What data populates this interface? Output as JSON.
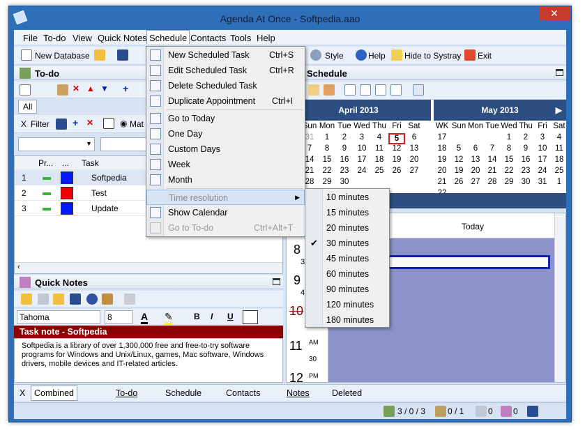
{
  "window": {
    "title": "Agenda At Once - Softpedia.aao",
    "close": "✕"
  },
  "menubar": {
    "items": [
      "File",
      "To-do",
      "View",
      "Quick Notes",
      "Schedule",
      "Contacts",
      "Tools",
      "Help"
    ]
  },
  "toolbar": {
    "new_database": "New Database",
    "style": "Style",
    "help": "Help",
    "hide": "Hide to Systray",
    "exit": "Exit"
  },
  "todo": {
    "title": "To-do",
    "all_tab": "All",
    "filter": "Filter",
    "mat": "Mat",
    "columns": {
      "pr": "Pr...",
      "dots": "...",
      "task": "Task"
    },
    "rows": [
      {
        "num": "1",
        "color": "#0018ff",
        "task": "Softpedia"
      },
      {
        "num": "2",
        "color": "#ee0000",
        "task": "Test"
      },
      {
        "num": "3",
        "color": "#0018ff",
        "task": "Update"
      }
    ]
  },
  "notes": {
    "title": "Quick Notes",
    "font": "Tahoma",
    "size": "8",
    "bold": "B",
    "italic": "I",
    "underline": "U",
    "task_note_title": "Task note - Softpedia",
    "body": "Softpedia is a library of over 1,300,000 free and free-to-try software programs for Windows and Unix/Linux, games, Mac software, Windows drivers, mobile devices and IT-related articles."
  },
  "schedule": {
    "title": "Schedule",
    "month1": "April 2013",
    "month2": "May 2013",
    "day_names1": [
      "Sun",
      "Mon",
      "Tue",
      "Wed",
      "Thu",
      "Fri",
      "Sat"
    ],
    "day_names2": [
      "WK",
      "Sun",
      "Mon",
      "Tue",
      "Wed",
      "Thu",
      "Fri",
      "Sat"
    ],
    "april": [
      [
        "31",
        "1",
        "2",
        "3",
        "4",
        "5",
        "6"
      ],
      [
        "7",
        "8",
        "9",
        "10",
        "11",
        "12",
        "13"
      ],
      [
        "14",
        "15",
        "16",
        "17",
        "18",
        "19",
        "20"
      ],
      [
        "21",
        "22",
        "23",
        "24",
        "25",
        "26",
        "27"
      ],
      [
        "28",
        "29",
        "30",
        "",
        "",
        "",
        ""
      ]
    ],
    "may": [
      [
        "17",
        "",
        "",
        "",
        "1",
        "2",
        "3",
        "4"
      ],
      [
        "18",
        "5",
        "6",
        "7",
        "8",
        "9",
        "10",
        "11"
      ],
      [
        "19",
        "12",
        "13",
        "14",
        "15",
        "16",
        "17",
        "18"
      ],
      [
        "20",
        "19",
        "20",
        "21",
        "22",
        "23",
        "24",
        "25"
      ],
      [
        "21",
        "26",
        "27",
        "28",
        "29",
        "30",
        "31",
        "1"
      ],
      [
        "22",
        "",
        "",
        "",
        "",
        "",
        "",
        ""
      ]
    ],
    "today_label": "Today",
    "hours": [
      "8",
      "9",
      "10",
      "11",
      "12"
    ],
    "am": "AM",
    "pm": "PM",
    "m30": "30",
    "m3": "3",
    "m4": "4"
  },
  "schedule_menu": {
    "items": [
      {
        "label": "New Scheduled Task",
        "shortcut": "Ctrl+S"
      },
      {
        "label": "Edit Scheduled Task",
        "shortcut": "Ctrl+R"
      },
      {
        "label": "Delete Scheduled Task",
        "shortcut": ""
      },
      {
        "label": "Duplicate Appointment",
        "shortcut": "Ctrl+I"
      },
      {
        "label": "Go to Today",
        "shortcut": ""
      },
      {
        "label": "One Day",
        "shortcut": ""
      },
      {
        "label": "Custom Days",
        "shortcut": ""
      },
      {
        "label": "Week",
        "shortcut": ""
      },
      {
        "label": "Month",
        "shortcut": ""
      },
      {
        "label": "Time resolution",
        "shortcut": ""
      },
      {
        "label": "Show Calendar",
        "shortcut": ""
      },
      {
        "label": "Go to To-do",
        "shortcut": "Ctrl+Alt+T"
      }
    ],
    "submenu": [
      "10 minutes",
      "15 minutes",
      "20 minutes",
      "30 minutes",
      "45 minutes",
      "60 minutes",
      "90 minutes",
      "120 minutes",
      "180 minutes"
    ],
    "checked": "30 minutes"
  },
  "tabs": {
    "close": "X",
    "items": [
      "Combined",
      "To-do",
      "Schedule",
      "Contacts",
      "Notes",
      "Deleted"
    ]
  },
  "status": {
    "todo": "3 / 0 / 3",
    "notes": "0 / 1",
    "contacts": "0",
    "deleted": "0"
  }
}
